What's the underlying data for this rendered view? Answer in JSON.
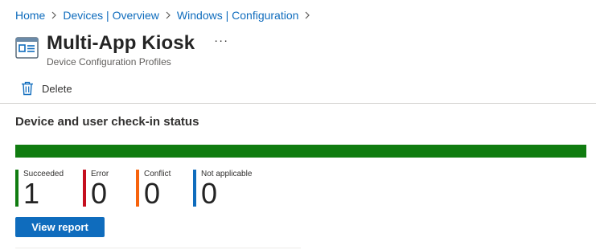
{
  "breadcrumb": [
    {
      "label": "Home"
    },
    {
      "label": "Devices | Overview"
    },
    {
      "label": "Windows | Configuration"
    }
  ],
  "header": {
    "title": "Multi-App Kiosk",
    "subtitle": "Device Configuration Profiles",
    "more_label": "···",
    "icon": "configuration-profile-icon"
  },
  "toolbar": {
    "delete_label": "Delete",
    "delete_icon": "trash-icon"
  },
  "status_section": {
    "title": "Device and user check-in status",
    "progress": {
      "succeeded_fraction": 1.0,
      "color": "#107c10",
      "track_color": "#e1dfdd"
    },
    "stats": [
      {
        "label": "Succeeded",
        "value": "1",
        "color": "#107c10"
      },
      {
        "label": "Error",
        "value": "0",
        "color": "#c50f1f"
      },
      {
        "label": "Conflict",
        "value": "0",
        "color": "#f7630c"
      },
      {
        "label": "Not applicable",
        "value": "0",
        "color": "#0f6cbd"
      }
    ],
    "view_report_label": "View report"
  },
  "colors": {
    "accent": "#0f6cbd"
  }
}
